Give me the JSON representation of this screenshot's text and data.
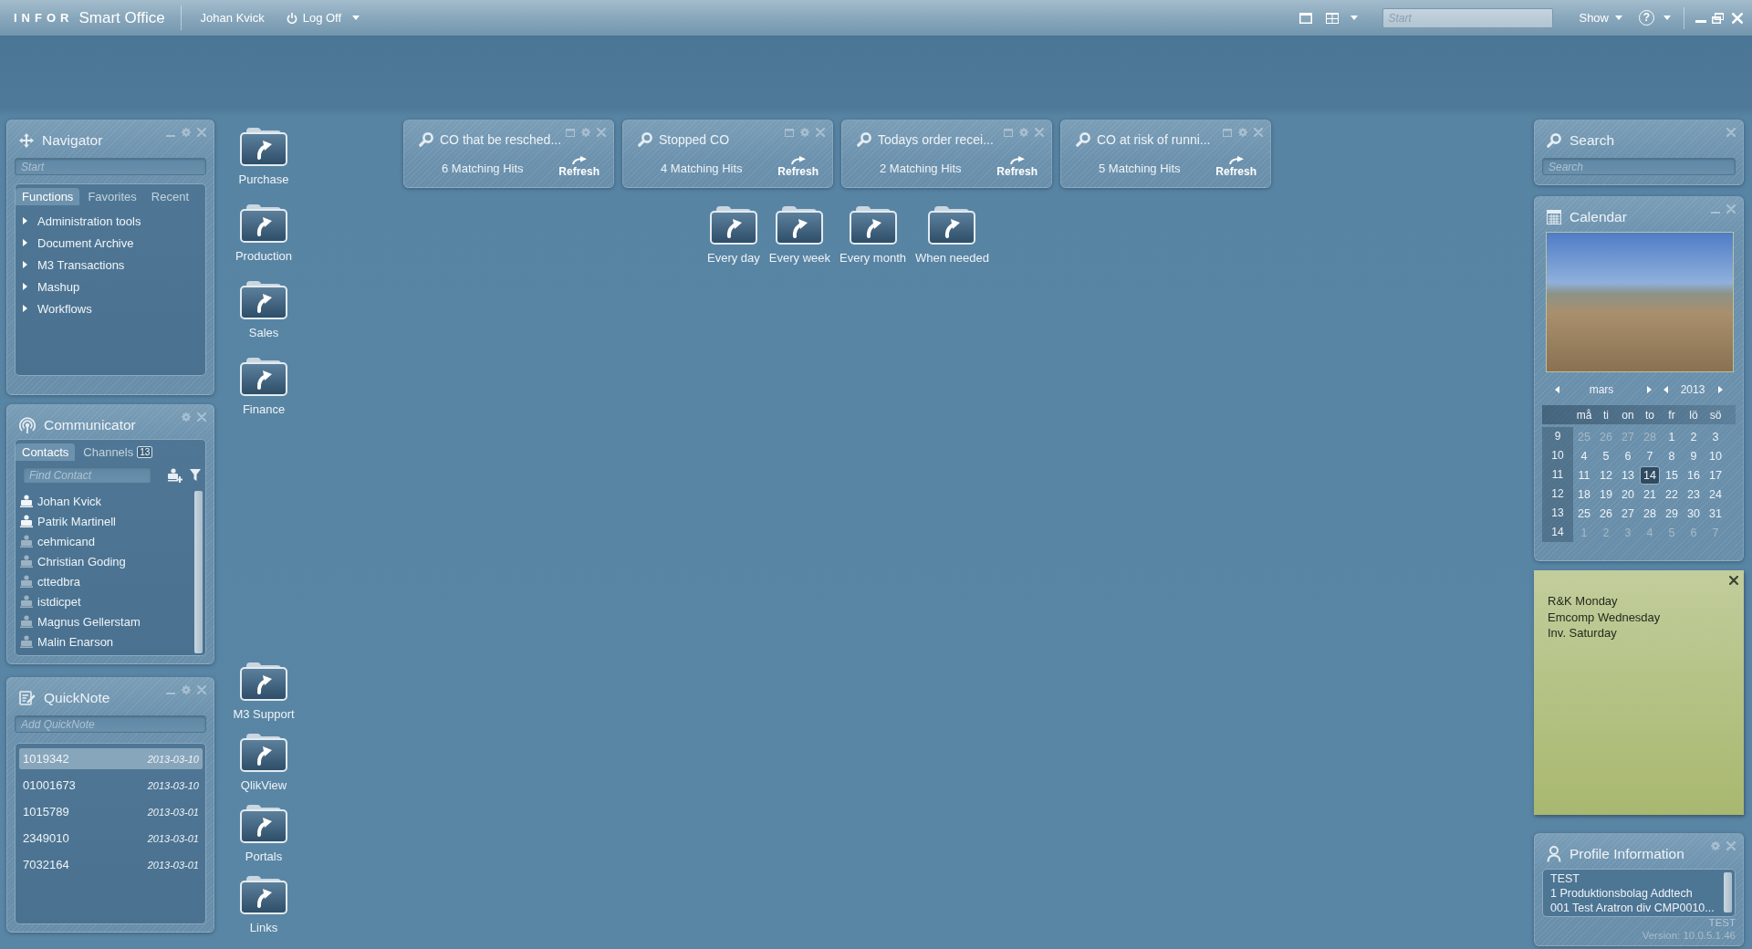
{
  "top_bar": {
    "logo": "INFOR",
    "app_name": "Smart Office",
    "user": "Johan Kvick",
    "log_off": "Log Off",
    "start_field": {
      "placeholder": "Start"
    },
    "show": "Show",
    "help": "?"
  },
  "navigator": {
    "title": "Navigator",
    "search": {
      "placeholder": "Start"
    },
    "tabs": [
      {
        "label": "Functions",
        "selected": true
      },
      {
        "label": "Favorites",
        "selected": false
      },
      {
        "label": "Recent",
        "selected": false
      }
    ],
    "items": [
      {
        "label": "Administration tools",
        "expanded": false
      },
      {
        "label": "Document Archive",
        "expanded": false
      },
      {
        "label": "M3 Transactions",
        "expanded": false
      },
      {
        "label": "Mashup",
        "expanded": false
      },
      {
        "label": "Workflows",
        "expanded": false
      }
    ]
  },
  "communicator": {
    "title": "Communicator",
    "tabs": [
      {
        "label": "Contacts",
        "selected": true
      },
      {
        "label": "Channels",
        "selected": false,
        "badge": "13"
      }
    ],
    "search": {
      "placeholder": "Find Contact"
    },
    "contacts": [
      {
        "name": "Johan Kvick",
        "online": true
      },
      {
        "name": "Patrik Martinell",
        "online": true
      },
      {
        "name": "cehmicand",
        "online": false
      },
      {
        "name": "Christian Goding",
        "online": false
      },
      {
        "name": "cttedbra",
        "online": false
      },
      {
        "name": "istdicpet",
        "online": false
      },
      {
        "name": "Magnus Gellerstam",
        "online": false
      },
      {
        "name": "Malin Enarson",
        "online": false
      }
    ]
  },
  "quicknote": {
    "title": "QuickNote",
    "input": {
      "placeholder": "Add QuickNote"
    },
    "notes": [
      {
        "text": "1019342",
        "date": "2013-03-10",
        "selected": true
      },
      {
        "text": "01001673",
        "date": "2013-03-10",
        "selected": false
      },
      {
        "text": "1015789",
        "date": "2013-03-01",
        "selected": false
      },
      {
        "text": "2349010",
        "date": "2013-03-01",
        "selected": false
      },
      {
        "text": "7032164",
        "date": "2013-03-01",
        "selected": false
      }
    ]
  },
  "shortcut_groups": [
    {
      "shortcuts": [
        {
          "label": "Purchase"
        },
        {
          "label": "Production"
        },
        {
          "label": "Sales"
        },
        {
          "label": "Finance"
        }
      ]
    },
    {
      "shortcuts": [
        {
          "label": "M3 Support"
        },
        {
          "label": "QlikView"
        },
        {
          "label": "Portals"
        },
        {
          "label": "Links"
        }
      ]
    }
  ],
  "search_widgets": [
    {
      "title": "CO that be resched...",
      "hits": "6 Matching Hits",
      "action": "Refresh"
    },
    {
      "title": "Stopped CO",
      "hits": "4 Matching Hits",
      "action": "Refresh"
    },
    {
      "title": "Todays order recei...",
      "hits": "2 Matching Hits",
      "action": "Refresh"
    },
    {
      "title": "CO at risk of runni...",
      "hits": "5 Matching Hits",
      "action": "Refresh"
    }
  ],
  "folder_shortcuts": [
    {
      "label": "Every day"
    },
    {
      "label": "Every week"
    },
    {
      "label": "Every month"
    },
    {
      "label": "When needed"
    }
  ],
  "search_panel": {
    "title": "Search",
    "input": {
      "placeholder": "Search"
    }
  },
  "calendar": {
    "title": "Calendar",
    "month": "mars",
    "year": "2013",
    "weekdays": [
      "må",
      "ti",
      "on",
      "to",
      "fr",
      "lö",
      "sö"
    ],
    "weeks": [
      {
        "number": "9",
        "days": [
          {
            "day": "25",
            "in_month": false,
            "selected": false
          },
          {
            "day": "26",
            "in_month": false,
            "selected": false
          },
          {
            "day": "27",
            "in_month": false,
            "selected": false
          },
          {
            "day": "28",
            "in_month": false,
            "selected": false
          },
          {
            "day": "1",
            "in_month": true,
            "selected": false
          },
          {
            "day": "2",
            "in_month": true,
            "selected": false
          },
          {
            "day": "3",
            "in_month": true,
            "selected": false
          }
        ]
      },
      {
        "number": "10",
        "days": [
          {
            "day": "4",
            "in_month": true,
            "selected": false
          },
          {
            "day": "5",
            "in_month": true,
            "selected": false
          },
          {
            "day": "6",
            "in_month": true,
            "selected": false
          },
          {
            "day": "7",
            "in_month": true,
            "selected": false
          },
          {
            "day": "8",
            "in_month": true,
            "selected": false
          },
          {
            "day": "9",
            "in_month": true,
            "selected": false
          },
          {
            "day": "10",
            "in_month": true,
            "selected": false
          }
        ]
      },
      {
        "number": "11",
        "days": [
          {
            "day": "11",
            "in_month": true,
            "selected": false
          },
          {
            "day": "12",
            "in_month": true,
            "selected": false
          },
          {
            "day": "13",
            "in_month": true,
            "selected": false
          },
          {
            "day": "14",
            "in_month": true,
            "selected": true
          },
          {
            "day": "15",
            "in_month": true,
            "selected": false
          },
          {
            "day": "16",
            "in_month": true,
            "selected": false
          },
          {
            "day": "17",
            "in_month": true,
            "selected": false
          }
        ]
      },
      {
        "number": "12",
        "days": [
          {
            "day": "18",
            "in_month": true,
            "selected": false
          },
          {
            "day": "19",
            "in_month": true,
            "selected": false
          },
          {
            "day": "20",
            "in_month": true,
            "selected": false
          },
          {
            "day": "21",
            "in_month": true,
            "selected": false
          },
          {
            "day": "22",
            "in_month": true,
            "selected": false
          },
          {
            "day": "23",
            "in_month": true,
            "selected": false
          },
          {
            "day": "24",
            "in_month": true,
            "selected": false
          }
        ]
      },
      {
        "number": "13",
        "days": [
          {
            "day": "25",
            "in_month": true,
            "selected": false
          },
          {
            "day": "26",
            "in_month": true,
            "selected": false
          },
          {
            "day": "27",
            "in_month": true,
            "selected": false
          },
          {
            "day": "28",
            "in_month": true,
            "selected": false
          },
          {
            "day": "29",
            "in_month": true,
            "selected": false
          },
          {
            "day": "30",
            "in_month": true,
            "selected": false
          },
          {
            "day": "31",
            "in_month": true,
            "selected": false
          }
        ]
      },
      {
        "number": "14",
        "days": [
          {
            "day": "1",
            "in_month": false,
            "selected": false
          },
          {
            "day": "2",
            "in_month": false,
            "selected": false
          },
          {
            "day": "3",
            "in_month": false,
            "selected": false
          },
          {
            "day": "4",
            "in_month": false,
            "selected": false
          },
          {
            "day": "5",
            "in_month": false,
            "selected": false
          },
          {
            "day": "6",
            "in_month": false,
            "selected": false
          },
          {
            "day": "7",
            "in_month": false,
            "selected": false
          }
        ]
      }
    ]
  },
  "sticky_note": {
    "lines": [
      "R&K Monday",
      "Emcomp Wednesday",
      "Inv. Saturday"
    ]
  },
  "profile": {
    "title": "Profile Information",
    "lines": [
      "TEST",
      "1 Produktionsbolag Addtech",
      "001 Test Aratron div CMP0010..."
    ]
  },
  "footer": {
    "environment": "TEST",
    "version": "Version: 10.0.5.1.46"
  }
}
